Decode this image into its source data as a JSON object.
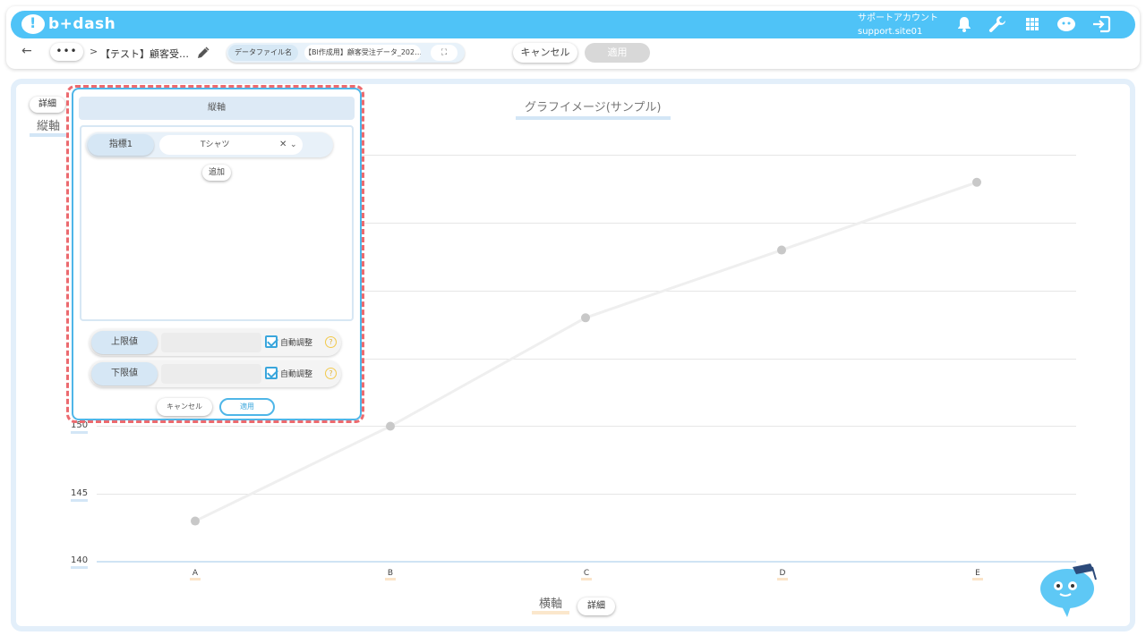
{
  "header": {
    "logo_text": "b+dash",
    "account_name": "サポートアカウント",
    "account_id": "support.site01",
    "icons": [
      "bell-icon",
      "wrench-icon",
      "grid-icon",
      "mascot-icon",
      "logout-icon"
    ]
  },
  "toolbar": {
    "back": "←",
    "more": "•••",
    "separator": ">",
    "title": "【テスト】顧客受…",
    "file_label": "データファイル名",
    "file_name": "【BI作成用】顧客受注データ_202…",
    "expand": "⛶",
    "cancel_label": "キャンセル",
    "apply_label": "適用"
  },
  "graph": {
    "title": "グラフイメージ(サンプル)",
    "y_detail": "詳細",
    "y_axis_title": "縦軸",
    "x_axis_title": "横軸",
    "x_detail": "詳細",
    "y_ticks": [
      "140",
      "145",
      "150"
    ]
  },
  "popup": {
    "header": "縦軸",
    "metric_label": "指標1",
    "metric_value": "Tシャツ",
    "clear": "✕",
    "chevron": "⌄",
    "add_label": "追加",
    "upper_label": "上限値",
    "lower_label": "下限値",
    "auto_label": "自動調整",
    "help": "?",
    "cancel_label": "キャンセル",
    "apply_label": "適用"
  },
  "chart_data": {
    "type": "line",
    "categories": [
      "A",
      "B",
      "C",
      "D",
      "E"
    ],
    "series": [
      {
        "values": [
          143,
          150,
          158,
          163,
          168
        ]
      }
    ],
    "ylim": [
      140,
      170
    ],
    "grid": true
  },
  "colors": {
    "accent": "#4fc3f7",
    "highlight": "#ec6a6f",
    "line": "#efefef",
    "point": "#c8c8c8"
  }
}
